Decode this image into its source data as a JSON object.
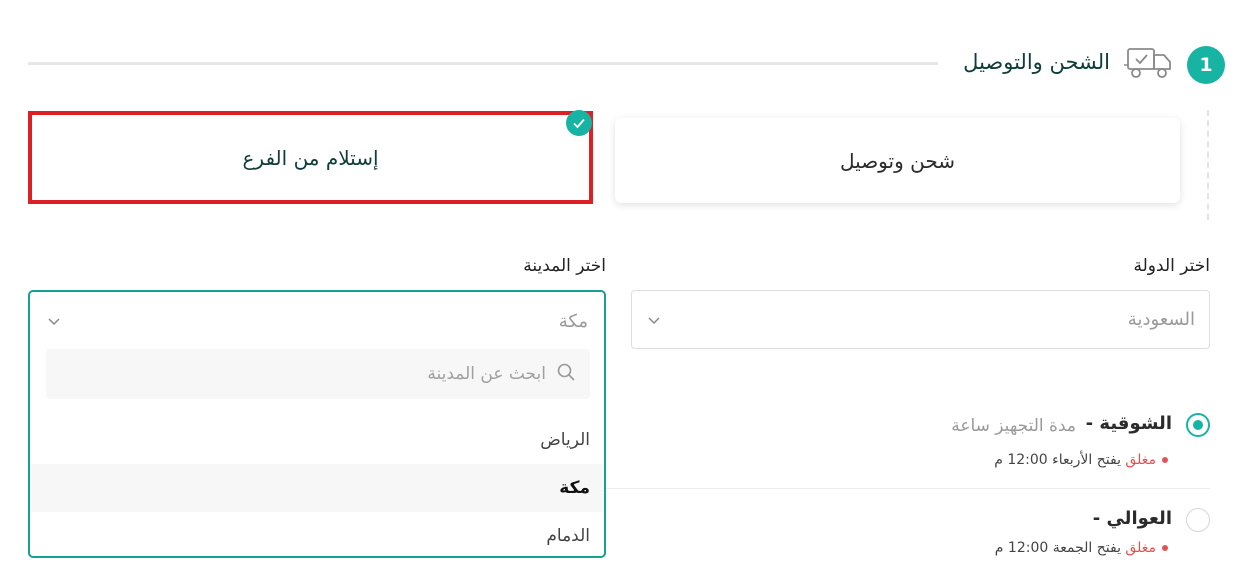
{
  "step": {
    "number": "1",
    "title": "الشحن والتوصيل",
    "icon": "truck-icon"
  },
  "delivery_options": {
    "shipping_label": "شحن وتوصيل",
    "pickup_label": "إستلام من الفرع",
    "selected": "pickup"
  },
  "country": {
    "label": "اختر الدولة",
    "value": "السعودية"
  },
  "city": {
    "label": "اختر المدينة",
    "value": "مكة",
    "search_placeholder": "ابحث عن المدينة",
    "options": [
      "الرياض",
      "مكة",
      "الدمام"
    ],
    "highlighted": "مكة"
  },
  "branches": [
    {
      "name": "الشوقية -",
      "prep_time": "مدة التجهيز ساعة",
      "status": "مغلق",
      "opens": "يفتح الأربعاء 12:00 م",
      "selected": true
    },
    {
      "name": "العوالي -",
      "status": "مغلق",
      "opens": "يفتح الجمعة 12:00 م",
      "selected": false
    }
  ],
  "colors": {
    "accent": "#17b3a3",
    "selected_border": "#dd1f26",
    "closed": "#e05454"
  }
}
